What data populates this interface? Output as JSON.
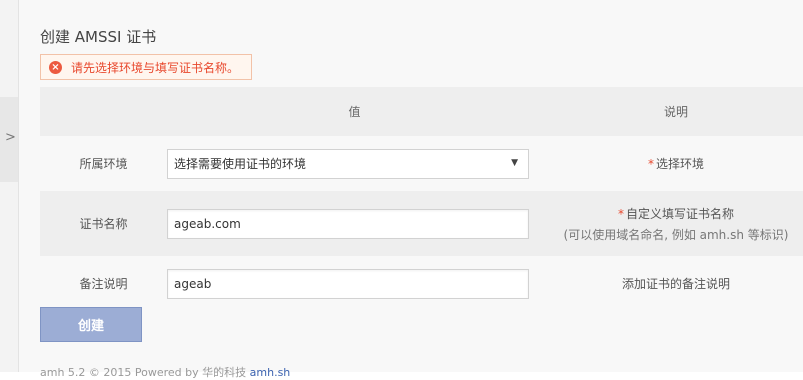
{
  "page": {
    "title": "创建 AMSSI 证书"
  },
  "alert": {
    "message": "请先选择环境与填写证书名称。"
  },
  "table": {
    "headers": [
      "",
      "值",
      "说明"
    ],
    "rows": [
      {
        "label": "所属环境",
        "value": "选择需要使用证书的环境",
        "hint": "选择环境",
        "hint_required": "*"
      },
      {
        "label": "证书名称",
        "value": "ageab.com",
        "hint": "自定义填写证书名称",
        "hint_required": "*",
        "hint_sub": "(可以使用域名命名, 例如 amh.sh 等标识)"
      },
      {
        "label": "备注说明",
        "value": "ageab",
        "hint": "添加证书的备注说明"
      }
    ]
  },
  "create_button": {
    "label": "创建"
  },
  "footer": {
    "text": "amh 5.2 © 2015 Powered by 华的科技",
    "link": "amh.sh"
  },
  "sidebar": {
    "toggle_glyph": ">"
  }
}
